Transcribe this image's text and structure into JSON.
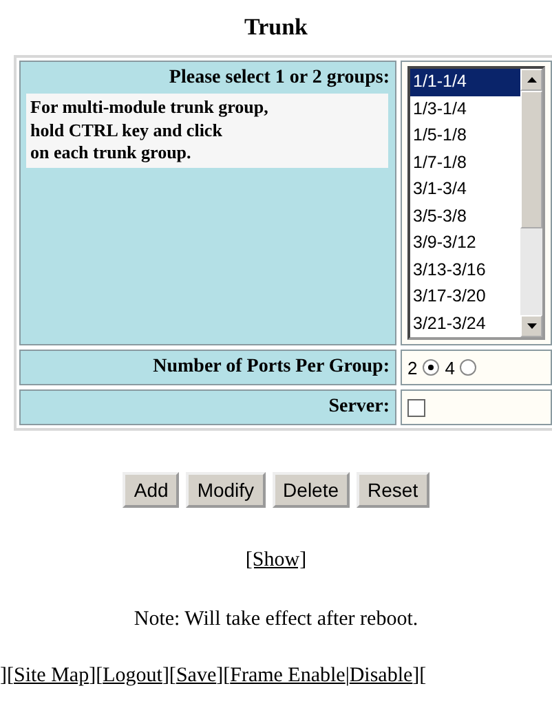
{
  "title": "Trunk",
  "groups": {
    "label": "Please select 1 or 2 groups:",
    "hint": "For multi-module trunk group,\nhold CTRL key and click\non each trunk group.",
    "options": [
      {
        "label": "1/1-1/4",
        "selected": true
      },
      {
        "label": "1/3-1/4",
        "selected": false
      },
      {
        "label": "1/5-1/8",
        "selected": false
      },
      {
        "label": "1/7-1/8",
        "selected": false
      },
      {
        "label": "3/1-3/4",
        "selected": false
      },
      {
        "label": "3/5-3/8",
        "selected": false
      },
      {
        "label": "3/9-3/12",
        "selected": false
      },
      {
        "label": "3/13-3/16",
        "selected": false
      },
      {
        "label": "3/17-3/20",
        "selected": false
      },
      {
        "label": "3/21-3/24",
        "selected": false
      }
    ]
  },
  "ports": {
    "label": "Number of Ports Per Group:",
    "options": [
      {
        "label": "2",
        "selected": true
      },
      {
        "label": "4",
        "selected": false
      }
    ]
  },
  "server": {
    "label": "Server:",
    "checked": false
  },
  "buttons": [
    "Add",
    "Modify",
    "Delete",
    "Reset"
  ],
  "show_link": "[Show]",
  "note": "Note: Will take effect after reboot.",
  "footer": [
    {
      "kind": "plain",
      "text": "]["
    },
    {
      "kind": "link",
      "text": "Site Map"
    },
    {
      "kind": "plain",
      "text": "]["
    },
    {
      "kind": "link",
      "text": "Logout"
    },
    {
      "kind": "plain",
      "text": "]["
    },
    {
      "kind": "link",
      "text": "Save"
    },
    {
      "kind": "plain",
      "text": "]["
    },
    {
      "kind": "link",
      "text": "Frame Enable"
    },
    {
      "kind": "plain",
      "text": "|"
    },
    {
      "kind": "link",
      "text": "Disable"
    },
    {
      "kind": "plain",
      "text": "]["
    }
  ]
}
